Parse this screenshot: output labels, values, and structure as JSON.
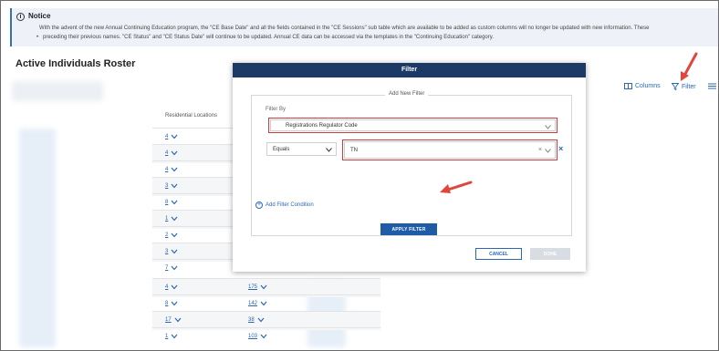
{
  "notice": {
    "icon": "info-icon",
    "title": "Notice",
    "line1": "With the advent of the new Annual Continuing Education program, the \"CE Base Date\" and all the fields contained in the \"CE Sessions\" sub table which are available to be added as custom columns will no longer be updated with new information. These",
    "line2": "preceding their previous names. \"CE Status\" and \"CE Status Date\" will continue to be updated. Annual CE data can be accessed via the templates in the \"Continuing Education\" category."
  },
  "page": {
    "title": "Active Individuals Roster"
  },
  "toolbar": {
    "columns_label": "Columns",
    "filter_label": "Filter"
  },
  "table": {
    "column_header": "Residential Locations",
    "rows": [
      {
        "a": "4",
        "b": ""
      },
      {
        "a": "4",
        "b": ""
      },
      {
        "a": "4",
        "b": ""
      },
      {
        "a": "3",
        "b": ""
      },
      {
        "a": "8",
        "b": ""
      },
      {
        "a": "1",
        "b": ""
      },
      {
        "a": "2",
        "b": ""
      },
      {
        "a": "3",
        "b": ""
      },
      {
        "a": "7",
        "b": ""
      },
      {
        "a": "4",
        "b": "175"
      },
      {
        "a": "8",
        "b": "142"
      },
      {
        "a": "17",
        "b": "38"
      },
      {
        "a": "1",
        "b": "103"
      }
    ]
  },
  "modal": {
    "title": "Filter",
    "section_legend": "Add New Filter",
    "filter_by_label": "Filter By",
    "filter_by_value": "Registrations Regulator Code",
    "operator_value": "Equals",
    "value_input": "TN",
    "add_condition_label": "Add Filter Condition",
    "apply_label": "APPLY FILTER",
    "cancel_label": "CANCEL",
    "done_label": "DONE"
  },
  "colors": {
    "accent": "#2b67b3",
    "modal_header": "#1d3a66",
    "highlight": "#d23b3b",
    "arrow": "#e0463c"
  }
}
